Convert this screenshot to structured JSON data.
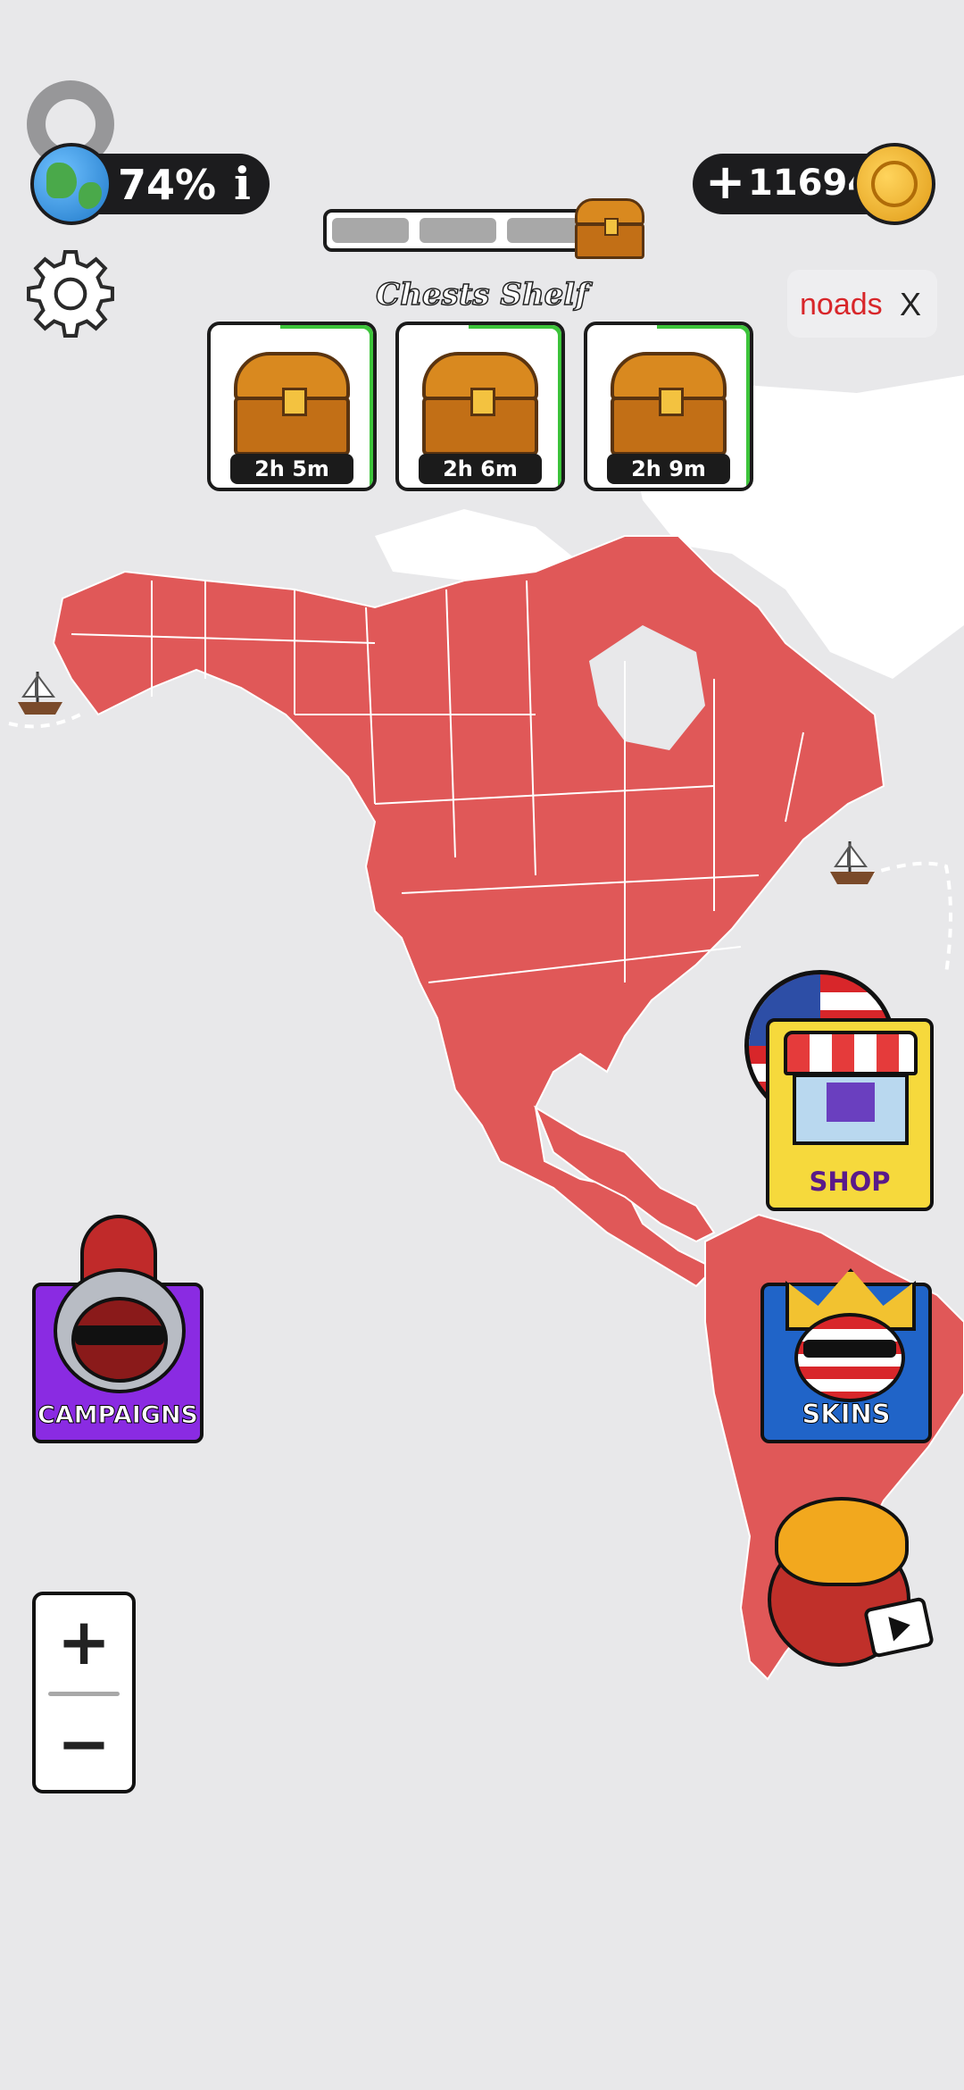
{
  "top_bar": {
    "progress_percent": "74%",
    "info_glyph": "i",
    "coins": "116945",
    "plus_glyph": "+"
  },
  "chest_progress": {
    "filled_segments": 3,
    "total_segments": 3
  },
  "chests_shelf": {
    "title": "Chests Shelf",
    "chests": [
      {
        "timer": "2h 5m"
      },
      {
        "timer": "2h 6m"
      },
      {
        "timer": "2h 9m"
      }
    ]
  },
  "noads": {
    "label": "noads",
    "close": "X"
  },
  "buttons": {
    "shop": "SHOP",
    "campaigns": "CAMPAIGNS",
    "skins": "SKINS"
  },
  "zoom": {
    "in": "+",
    "out": "−"
  },
  "colors": {
    "territory": "#e05858",
    "background": "#e8e8ea",
    "accent_green": "#3cc43a",
    "shop_yellow": "#f6d93c",
    "skins_blue": "#2064c8",
    "campaigns_purple": "#8a2be2"
  }
}
